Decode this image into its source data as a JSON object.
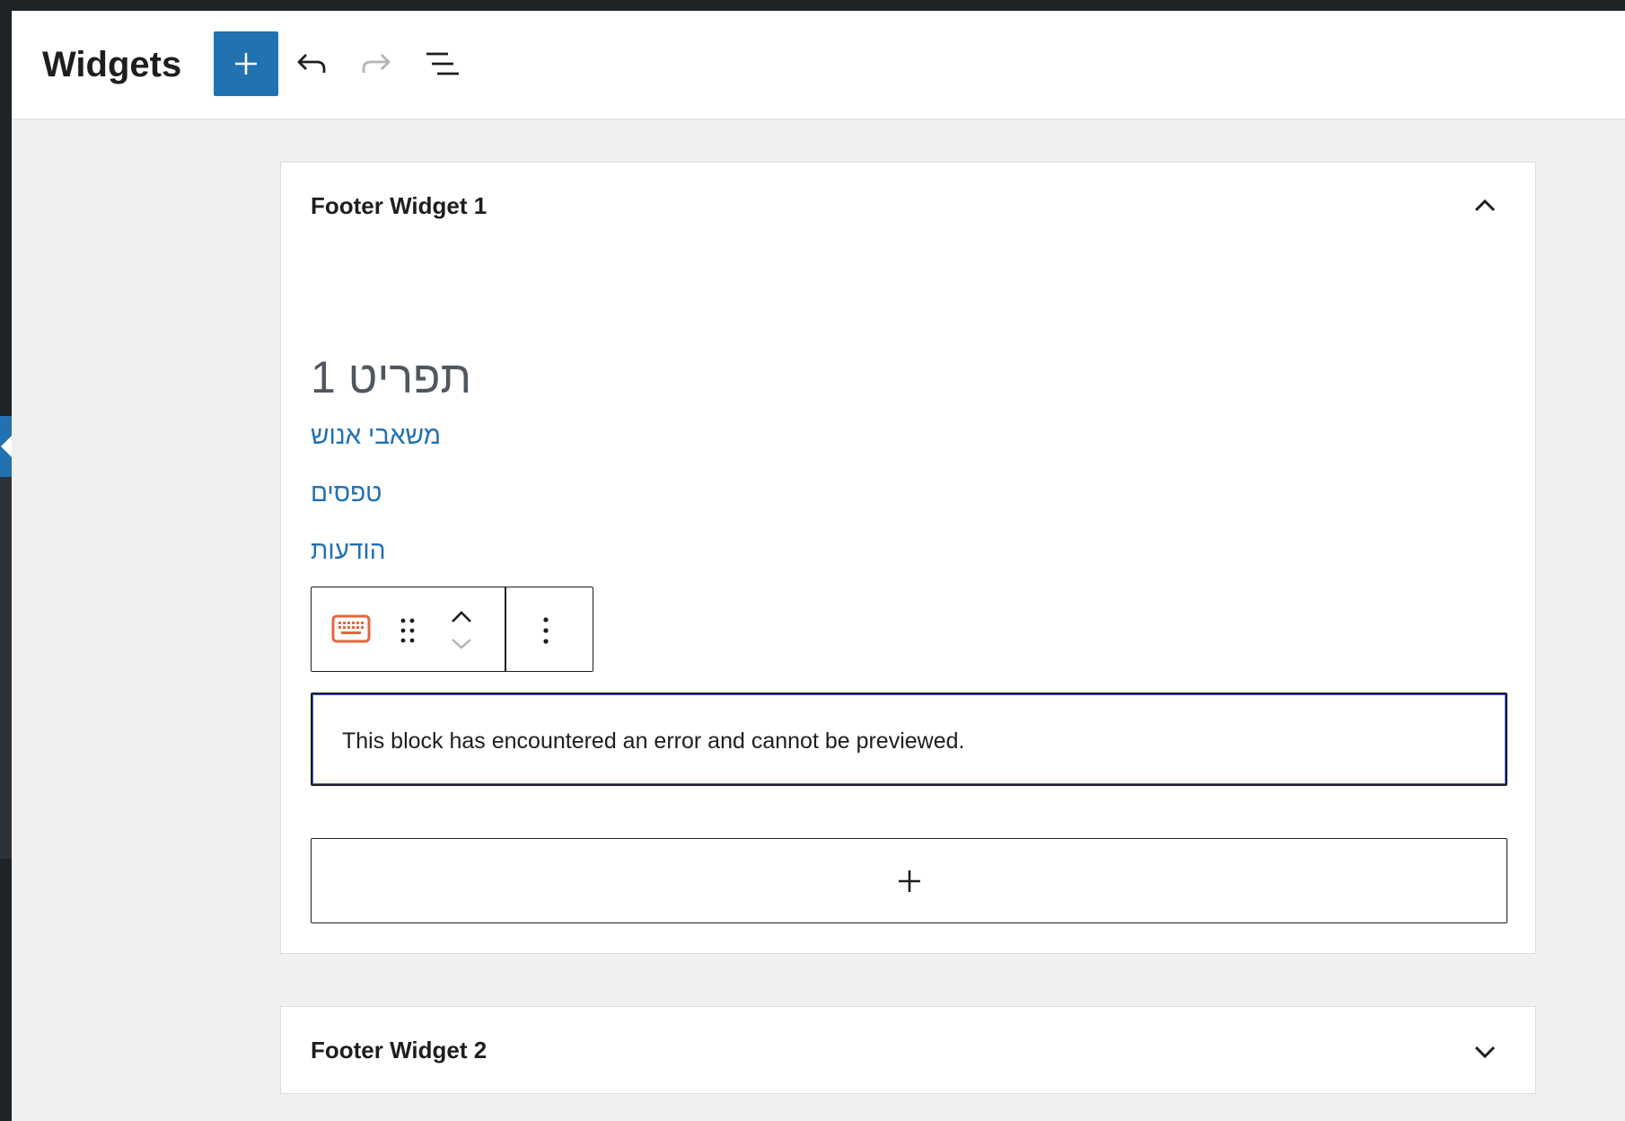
{
  "header": {
    "title": "Widgets",
    "add_block_icon": "plus-icon",
    "undo_icon": "undo-icon",
    "redo_icon": "redo-icon",
    "list_view_icon": "list-view-icon"
  },
  "areas": [
    {
      "title": "Footer Widget 1",
      "expanded": true,
      "toggle_icon": "chevron-up-icon",
      "content": {
        "heading": "תפריט 1",
        "links": [
          "משאבי אנוש",
          "טפסים",
          "הודעות"
        ]
      },
      "block_toolbar": {
        "block_icon": "keyboard-icon",
        "drag_icon": "drag-handle-icon",
        "move_up_icon": "chevron-up-icon",
        "move_down_icon": "chevron-down-icon",
        "options_icon": "more-vertical-icon"
      },
      "error_message": "This block has encountered an error and cannot be previewed.",
      "appender_icon": "plus-icon"
    },
    {
      "title": "Footer Widget 2",
      "expanded": false,
      "toggle_icon": "chevron-down-icon"
    }
  ],
  "colors": {
    "accent": "#2271b1",
    "block_icon": "#e2683c",
    "text": "#1e1e1e",
    "canvas": "#f0f0f0"
  }
}
